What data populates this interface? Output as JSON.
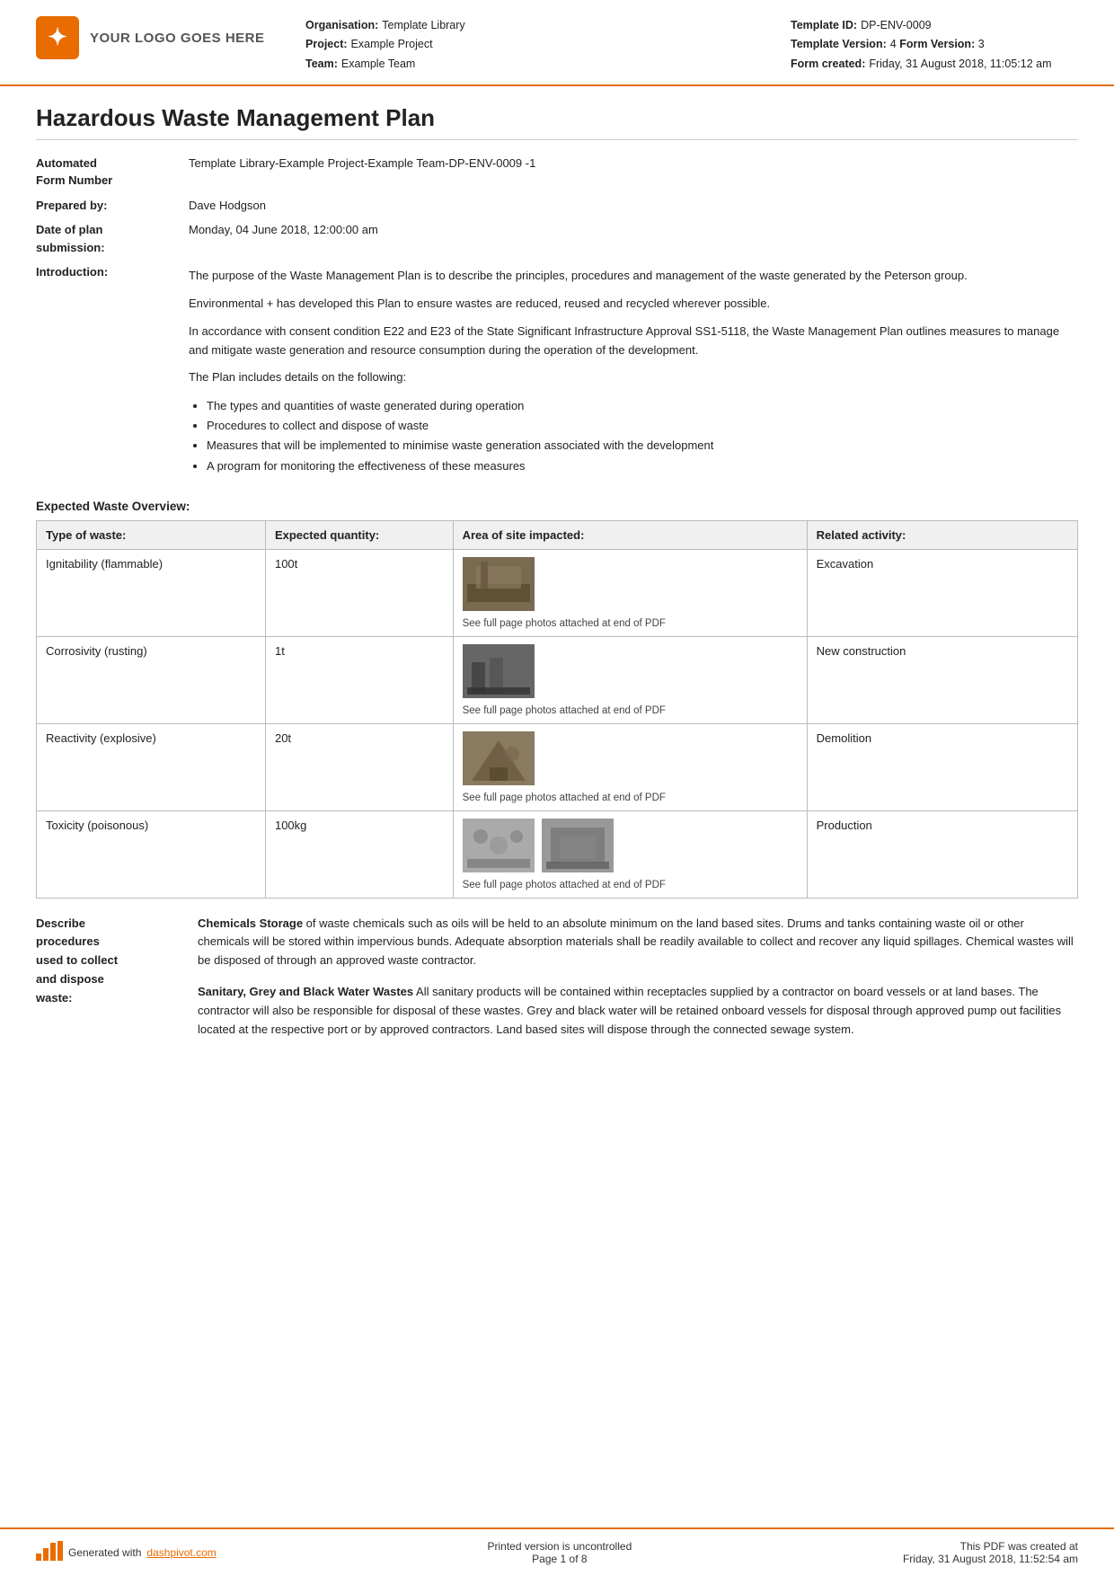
{
  "header": {
    "logo_text": "YOUR LOGO GOES HERE",
    "org_label": "Organisation:",
    "org_value": "Template Library",
    "project_label": "Project:",
    "project_value": "Example Project",
    "team_label": "Team:",
    "team_value": "Example Team",
    "template_id_label": "Template ID:",
    "template_id_value": "DP-ENV-0009",
    "template_version_label": "Template Version:",
    "template_version_value": "4",
    "form_version_label": "Form Version:",
    "form_version_value": "3",
    "form_created_label": "Form created:",
    "form_created_value": "Friday, 31 August 2018, 11:05:12 am"
  },
  "document": {
    "title": "Hazardous Waste Management Plan",
    "automated_form_label": "Automated\nForm Number",
    "automated_form_value": "Template Library-Example Project-Example Team-DP-ENV-0009   -1",
    "prepared_by_label": "Prepared by:",
    "prepared_by_value": "Dave Hodgson",
    "date_of_plan_label": "Date of plan\nsubmission:",
    "date_of_plan_value": "Monday, 04 June 2018, 12:00:00 am",
    "introduction_label": "Introduction:",
    "introduction_para1": "The purpose of the Waste Management Plan is to describe the principles, procedures and management of the waste generated by the Peterson group.",
    "introduction_para2": "Environmental + has developed this Plan to ensure wastes are reduced, reused and recycled wherever possible.",
    "introduction_para3": "In accordance with consent condition E22 and E23 of the State Significant Infrastructure Approval SS1-5118, the Waste Management Plan outlines measures to manage and mitigate waste generation and resource consumption during the operation of the development.",
    "introduction_para4": "The Plan includes details on the following:",
    "bullets": [
      "The types and quantities of waste generated during operation",
      "Procedures to collect and dispose of waste",
      "Measures that will be implemented to minimise waste generation associated with the development",
      "A program for monitoring the effectiveness of these measures"
    ],
    "expected_waste_heading": "Expected Waste Overview:",
    "table_headers": [
      "Type of waste:",
      "Expected quantity:",
      "Area of site impacted:",
      "Related activity:"
    ],
    "table_rows": [
      {
        "type": "Ignitability (flammable)",
        "quantity": "100t",
        "photo_caption": "See full page photos attached at end of PDF",
        "activity": "Excavation",
        "photo_type": "excavation"
      },
      {
        "type": "Corrosivity (rusting)",
        "quantity": "1t",
        "photo_caption": "See full page photos attached at end of PDF",
        "activity": "New construction",
        "photo_type": "construction"
      },
      {
        "type": "Reactivity (explosive)",
        "quantity": "20t",
        "photo_caption": "See full page photos attached at end of PDF",
        "activity": "Demolition",
        "photo_type": "demolition"
      },
      {
        "type": "Toxicity (poisonous)",
        "quantity": "100kg",
        "photo_caption": "See full page photos attached at end of PDF",
        "activity": "Production",
        "photo_type": "production"
      }
    ],
    "describe_procedures_label": "Describe\nprocedures\nused to collect\nand dispose\nwaste:",
    "describe_procedures_para1": "Chemicals Storage of waste chemicals such as oils will be held to an absolute minimum on the land based sites. Drums and tanks containing waste oil or other chemicals will be stored within impervious bunds. Adequate absorption materials shall be readily available to collect and recover any liquid spillages. Chemical wastes will be disposed of through an approved waste contractor.",
    "describe_procedures_para1_bold": "Chemicals Storage",
    "describe_procedures_para2_bold": "Sanitary, Grey and Black Water Wastes",
    "describe_procedures_para2": "All sanitary products will be contained within receptacles supplied by a contractor on board vessels or at land bases. The contractor will also be responsible for disposal of these wastes. Grey and black water will be retained onboard vessels for disposal through approved pump out facilities located at the respective port or by approved contractors. Land based sites will dispose through the connected sewage system."
  },
  "footer": {
    "generated_with": "Generated with",
    "footer_link_text": "dashpivot.com",
    "printed_version": "Printed version is uncontrolled",
    "page_info": "Page 1 of 8",
    "pdf_created": "This PDF was created at",
    "pdf_created_date": "Friday, 31 August 2018, 11:52:54 am"
  }
}
